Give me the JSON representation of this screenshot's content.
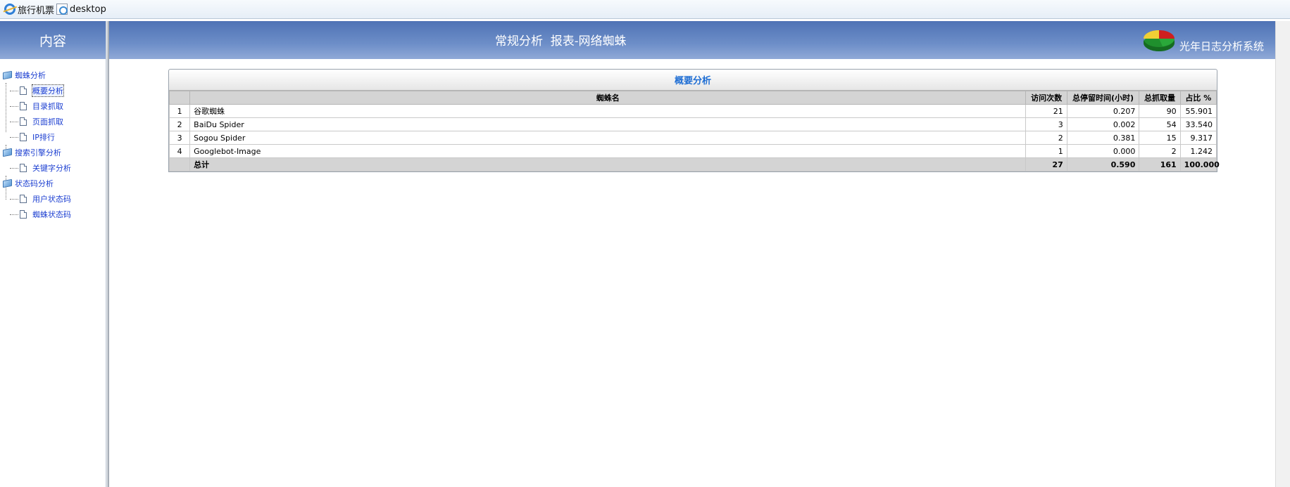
{
  "favorites": [
    {
      "label": "旅行机票",
      "icon": "ie-icon"
    },
    {
      "label": "desktop",
      "icon": "page-icon"
    }
  ],
  "sidebar": {
    "title": "内容",
    "tree": [
      {
        "label": "蜘蛛分析",
        "children": [
          "概要分析",
          "目录抓取",
          "页面抓取",
          "IP排行"
        ]
      },
      {
        "label": "搜索引擎分析",
        "children": [
          "关键字分析"
        ]
      },
      {
        "label": "状态码分析",
        "children": [
          "用户状态码",
          "蜘蛛状态码"
        ]
      }
    ],
    "active_item": "概要分析"
  },
  "header": {
    "title": "常规分析  报表-网络蜘蛛",
    "logo_text": "光年日志分析系统"
  },
  "report": {
    "caption": "概要分析",
    "columns": [
      "",
      "蜘蛛名",
      "访问次数",
      "总停留时间(小时)",
      "总抓取量",
      "占比 %"
    ],
    "rows": [
      [
        "1",
        "谷歌蜘蛛",
        "21",
        "0.207",
        "90",
        "55.901"
      ],
      [
        "2",
        "BaiDu Spider",
        "3",
        "0.002",
        "54",
        "33.540"
      ],
      [
        "3",
        "Sogou Spider",
        "2",
        "0.381",
        "15",
        "9.317"
      ],
      [
        "4",
        "Googlebot-Image",
        "1",
        "0.000",
        "2",
        "1.242"
      ]
    ],
    "total": [
      "",
      "总计",
      "27",
      "0.590",
      "161",
      "100.000"
    ]
  },
  "colors": {
    "header_gradient_top": "#4f73b5",
    "header_gradient_bottom": "#90a9d7",
    "link_blue": "#1c3fd1",
    "caption_blue": "#1f6ed4"
  }
}
